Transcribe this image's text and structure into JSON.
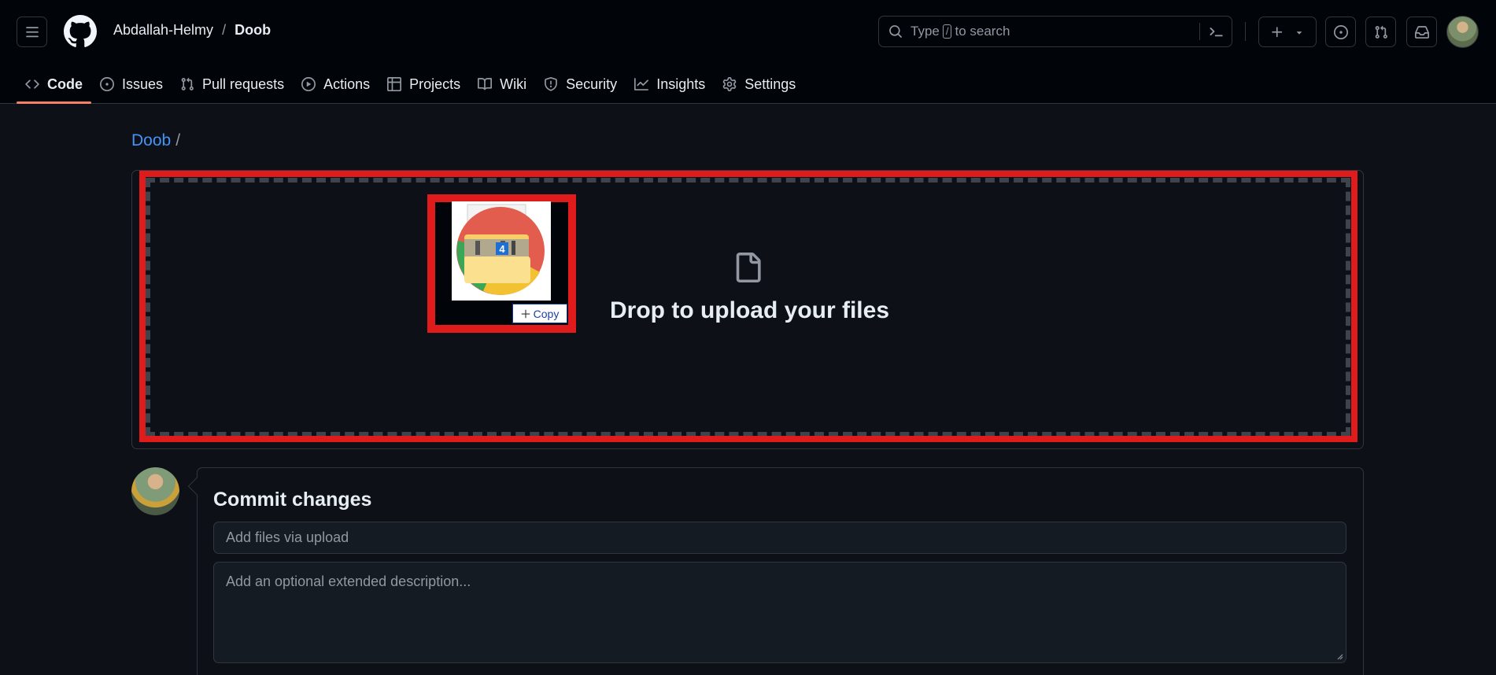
{
  "header": {
    "owner": "Abdallah-Helmy",
    "separator": "/",
    "repo": "Doob",
    "search": {
      "prefix": "Type",
      "key": "/",
      "suffix": "to search"
    }
  },
  "tabs": [
    {
      "label": "Code",
      "icon": "code-icon",
      "active": true
    },
    {
      "label": "Issues",
      "icon": "issue-opened-icon"
    },
    {
      "label": "Pull requests",
      "icon": "git-pull-request-icon"
    },
    {
      "label": "Actions",
      "icon": "play-icon"
    },
    {
      "label": "Projects",
      "icon": "table-icon"
    },
    {
      "label": "Wiki",
      "icon": "book-icon"
    },
    {
      "label": "Security",
      "icon": "shield-icon"
    },
    {
      "label": "Insights",
      "icon": "graph-icon"
    },
    {
      "label": "Settings",
      "icon": "gear-icon"
    }
  ],
  "breadcrumb": {
    "repo": "Doob",
    "slash": "/"
  },
  "dropzone": {
    "text": "Drop to upload your files",
    "drag_preview": {
      "badge": "4",
      "copy_label": "Copy"
    }
  },
  "commit": {
    "title": "Commit changes",
    "summary_placeholder": "Add files via upload",
    "description_placeholder": "Add an optional extended description..."
  },
  "colors": {
    "background": "#0d1117",
    "header": "#010409",
    "accent_link": "#4493f8",
    "tab_underline": "#f78166",
    "highlight": "#e01b1b"
  }
}
